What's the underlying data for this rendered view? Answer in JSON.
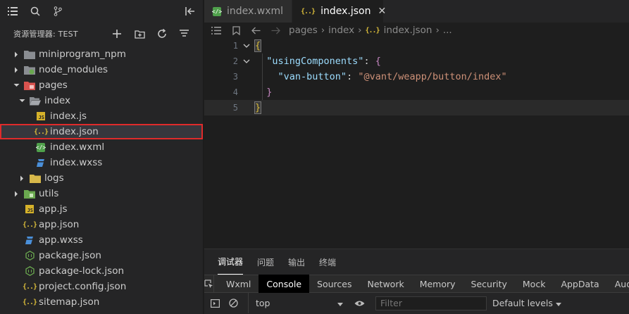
{
  "sidebar": {
    "explorer_title": "资源管理器: TEST",
    "tree": [
      {
        "label": "miniprogram_npm",
        "kind": "folder",
        "state": "collapsed"
      },
      {
        "label": "node_modules",
        "kind": "folder-node",
        "state": "collapsed"
      },
      {
        "label": "pages",
        "kind": "folder-pages",
        "state": "expanded"
      },
      {
        "label": "index",
        "kind": "folder-open",
        "state": "expanded"
      },
      {
        "label": "index.js",
        "kind": "js"
      },
      {
        "label": "index.json",
        "kind": "json",
        "selected": true
      },
      {
        "label": "index.wxml",
        "kind": "wxml"
      },
      {
        "label": "index.wxss",
        "kind": "wxss"
      },
      {
        "label": "logs",
        "kind": "folder",
        "state": "collapsed"
      },
      {
        "label": "utils",
        "kind": "folder-utils",
        "state": "collapsed"
      },
      {
        "label": "app.js",
        "kind": "js"
      },
      {
        "label": "app.json",
        "kind": "json"
      },
      {
        "label": "app.wxss",
        "kind": "wxss"
      },
      {
        "label": "package.json",
        "kind": "node"
      },
      {
        "label": "package-lock.json",
        "kind": "node"
      },
      {
        "label": "project.config.json",
        "kind": "json"
      },
      {
        "label": "sitemap.json",
        "kind": "json"
      }
    ]
  },
  "editor": {
    "tabs": [
      {
        "label": "index.wxml",
        "active": false
      },
      {
        "label": "index.json",
        "active": true,
        "close": "✕"
      }
    ],
    "breadcrumb": [
      "pages",
      "index",
      "index.json",
      "..."
    ],
    "line_numbers": [
      "1",
      "2",
      "3",
      "4",
      "5"
    ],
    "code": {
      "l1_brace": "{",
      "l2_key": "\"usingComponents\"",
      "l2_colon": ": ",
      "l2_brace": "{",
      "l3_key": "\"van-button\"",
      "l3_colon": ": ",
      "l3_value": "\"@vant/weapp/button/index\"",
      "l4_brace": "}",
      "l5_brace": "}"
    }
  },
  "panel": {
    "tabs": [
      "调试器",
      "问题",
      "输出",
      "终端"
    ],
    "devtools_tabs": [
      "Wxml",
      "Console",
      "Sources",
      "Network",
      "Memory",
      "Security",
      "Mock",
      "AppData",
      "Audits"
    ],
    "active_devtools_tab": "Console",
    "context": "top",
    "filter_placeholder": "Filter",
    "levels": "Default levels"
  },
  "colors": {
    "selection_outline": "#e02b2b",
    "json_icon": "#d7ba3a",
    "string": "#ce9178",
    "key": "#9cdcfe"
  }
}
